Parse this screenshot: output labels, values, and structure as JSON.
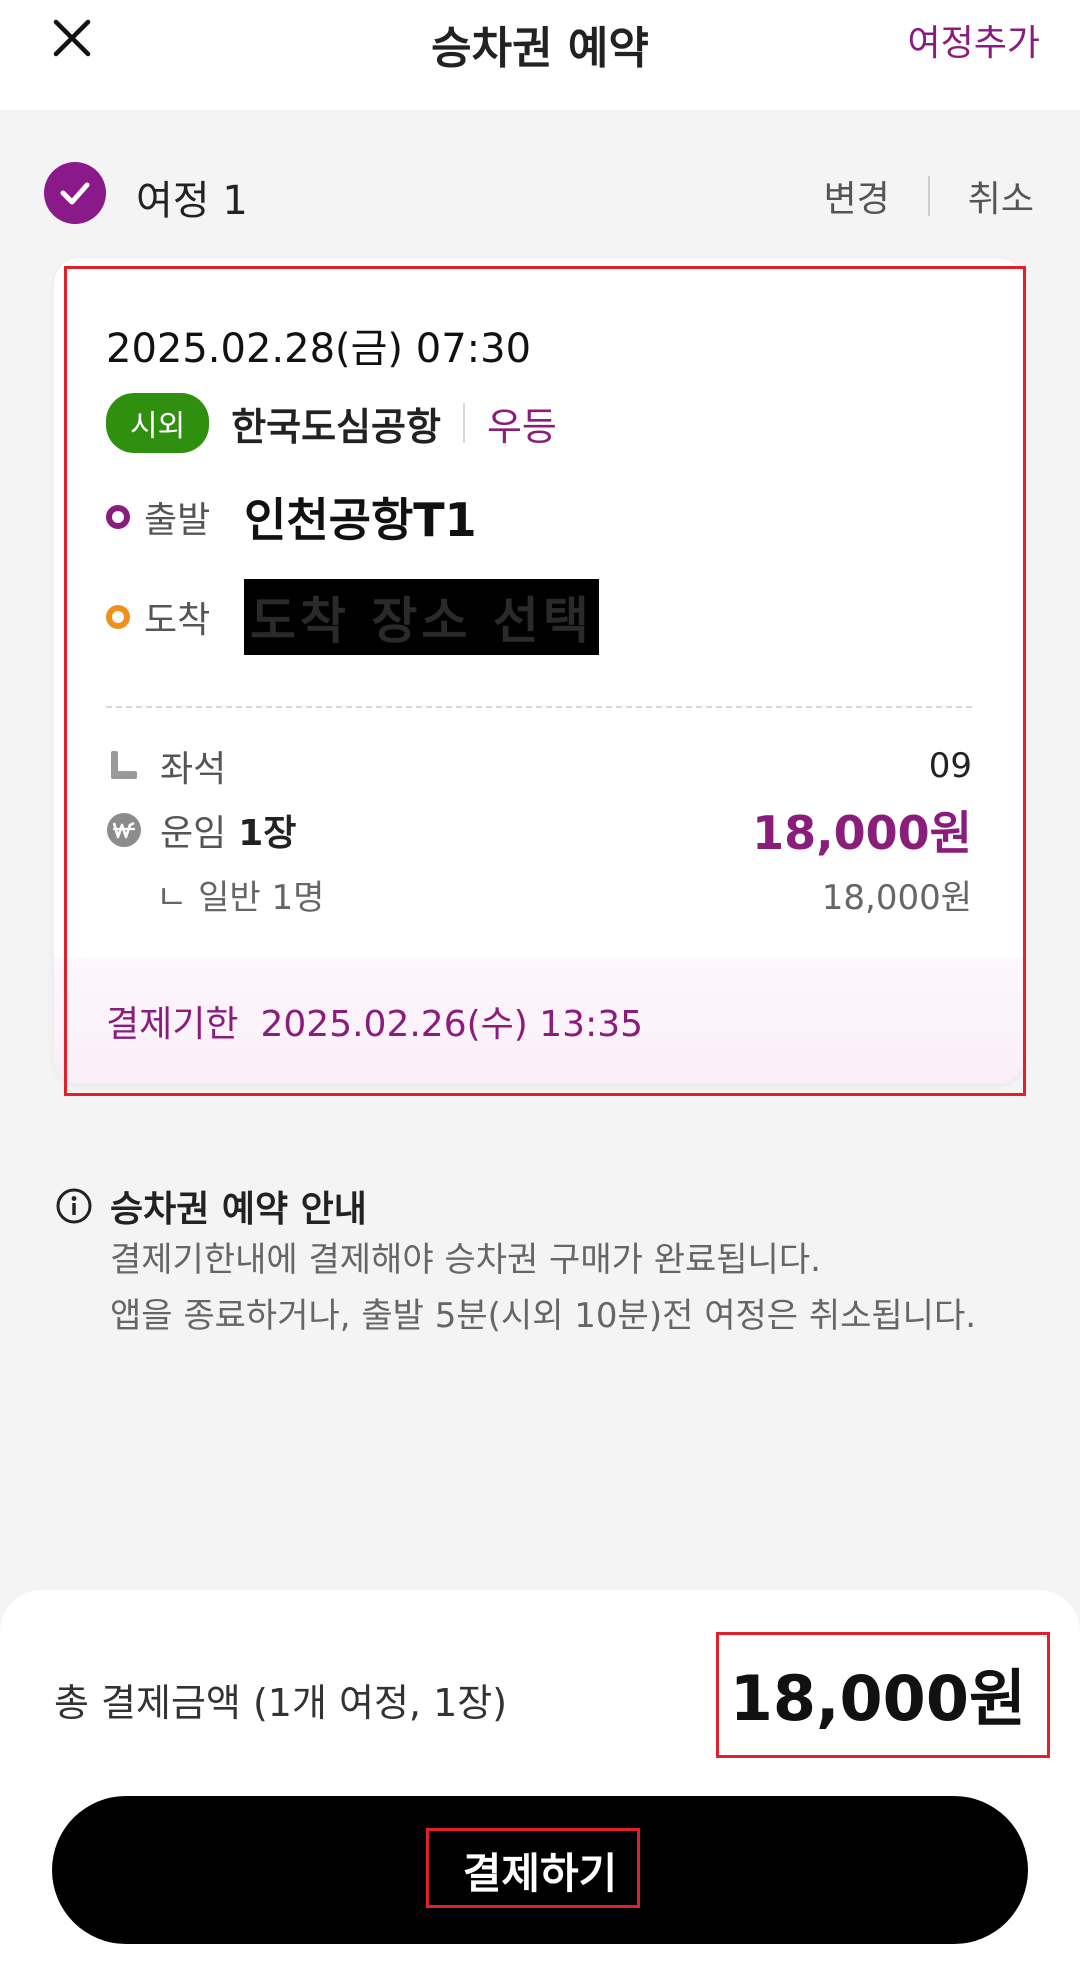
{
  "header": {
    "title": "승차권 예약",
    "add_trip": "여정추가"
  },
  "trip": {
    "label": "여정 1",
    "change": "변경",
    "cancel": "취소",
    "datetime": "2025.02.28(금) 07:30",
    "badge": "시외",
    "company": "한국도심공항",
    "grade": "우등",
    "departure_label": "출발",
    "departure_value": "인천공항T1",
    "arrival_label": "도착",
    "arrival_value": "도착 장소 선택",
    "seat_label": "좌석",
    "seat_value": "09",
    "fare_label": "운임",
    "fare_count": "1장",
    "fare_value": "18,000원",
    "sub_label": "ㄴ 일반 1명",
    "sub_value": "18,000원",
    "deadline_label": "결제기한",
    "deadline_value": "2025.02.26(수) 13:35"
  },
  "notice": {
    "title": "승차권 예약 안내",
    "lines": [
      "결제기한내에 결제해야 승차권 구매가 완료됩니다.",
      "앱을 종료하거나, 출발 5분(시외 10분)전 여정은 취소됩니다."
    ]
  },
  "footer": {
    "total_label": "총 결제금액 (1개 여정, 1장)",
    "total_value": "18,000원",
    "pay_button": "결제하기"
  },
  "colors": {
    "accent": "#8a1c7c",
    "badge_green": "#2f8f0f",
    "departure_dot": "#8a1c7c",
    "arrival_dot": "#f0901a",
    "highlight_red": "#e0202a"
  },
  "icons": {
    "close": "close-icon",
    "trip_check": "check-circle-icon",
    "seat": "seat-icon",
    "fare": "won-icon",
    "notice": "info-icon"
  }
}
